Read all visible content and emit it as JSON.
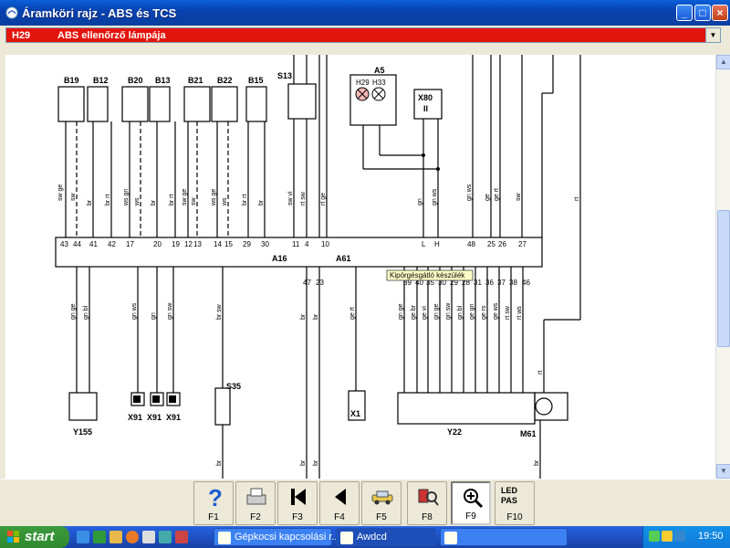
{
  "window": {
    "title": "Áramköri rajz - ABS és TCS"
  },
  "selector": {
    "code": "H29",
    "label": "ABS ellenőrző lámpája"
  },
  "diagram": {
    "connectors": {
      "a16": "A16",
      "a61": "A61"
    },
    "components_top": [
      "B19",
      "B12",
      "B20",
      "B13",
      "B21",
      "B22",
      "B15",
      "S13",
      "A5",
      "X80 II"
    ],
    "components_bottom": [
      "Y155",
      "X91",
      "X91",
      "X91",
      "S35",
      "X1",
      "Y22",
      "M61"
    ],
    "tooltip": "Kipörgésgátló készülék",
    "a5_lamps": [
      "H29",
      "H33"
    ]
  },
  "toolbar": {
    "keys": [
      {
        "label": "F1",
        "icon": "help-icon"
      },
      {
        "label": "F2",
        "icon": "printer-icon"
      },
      {
        "label": "F3",
        "icon": "first-page-icon"
      },
      {
        "label": "F4",
        "icon": "previous-page-icon"
      },
      {
        "label": "F5",
        "icon": "car-icon"
      },
      {
        "label": "F8",
        "icon": "component-search-icon"
      },
      {
        "label": "F9",
        "icon": "zoom-icon"
      },
      {
        "label": "F10",
        "icon": "led-pas-icon",
        "text1": "LED",
        "text2": "PAS"
      }
    ]
  },
  "taskbar": {
    "start": "start",
    "tasks": [
      {
        "label": "Gépkocsi kapcsolási r..."
      },
      {
        "label": "Awdcd"
      }
    ],
    "clock": "19:50"
  },
  "colors": {
    "title_blue": "#0842b0",
    "selector_red": "#e3140c"
  }
}
